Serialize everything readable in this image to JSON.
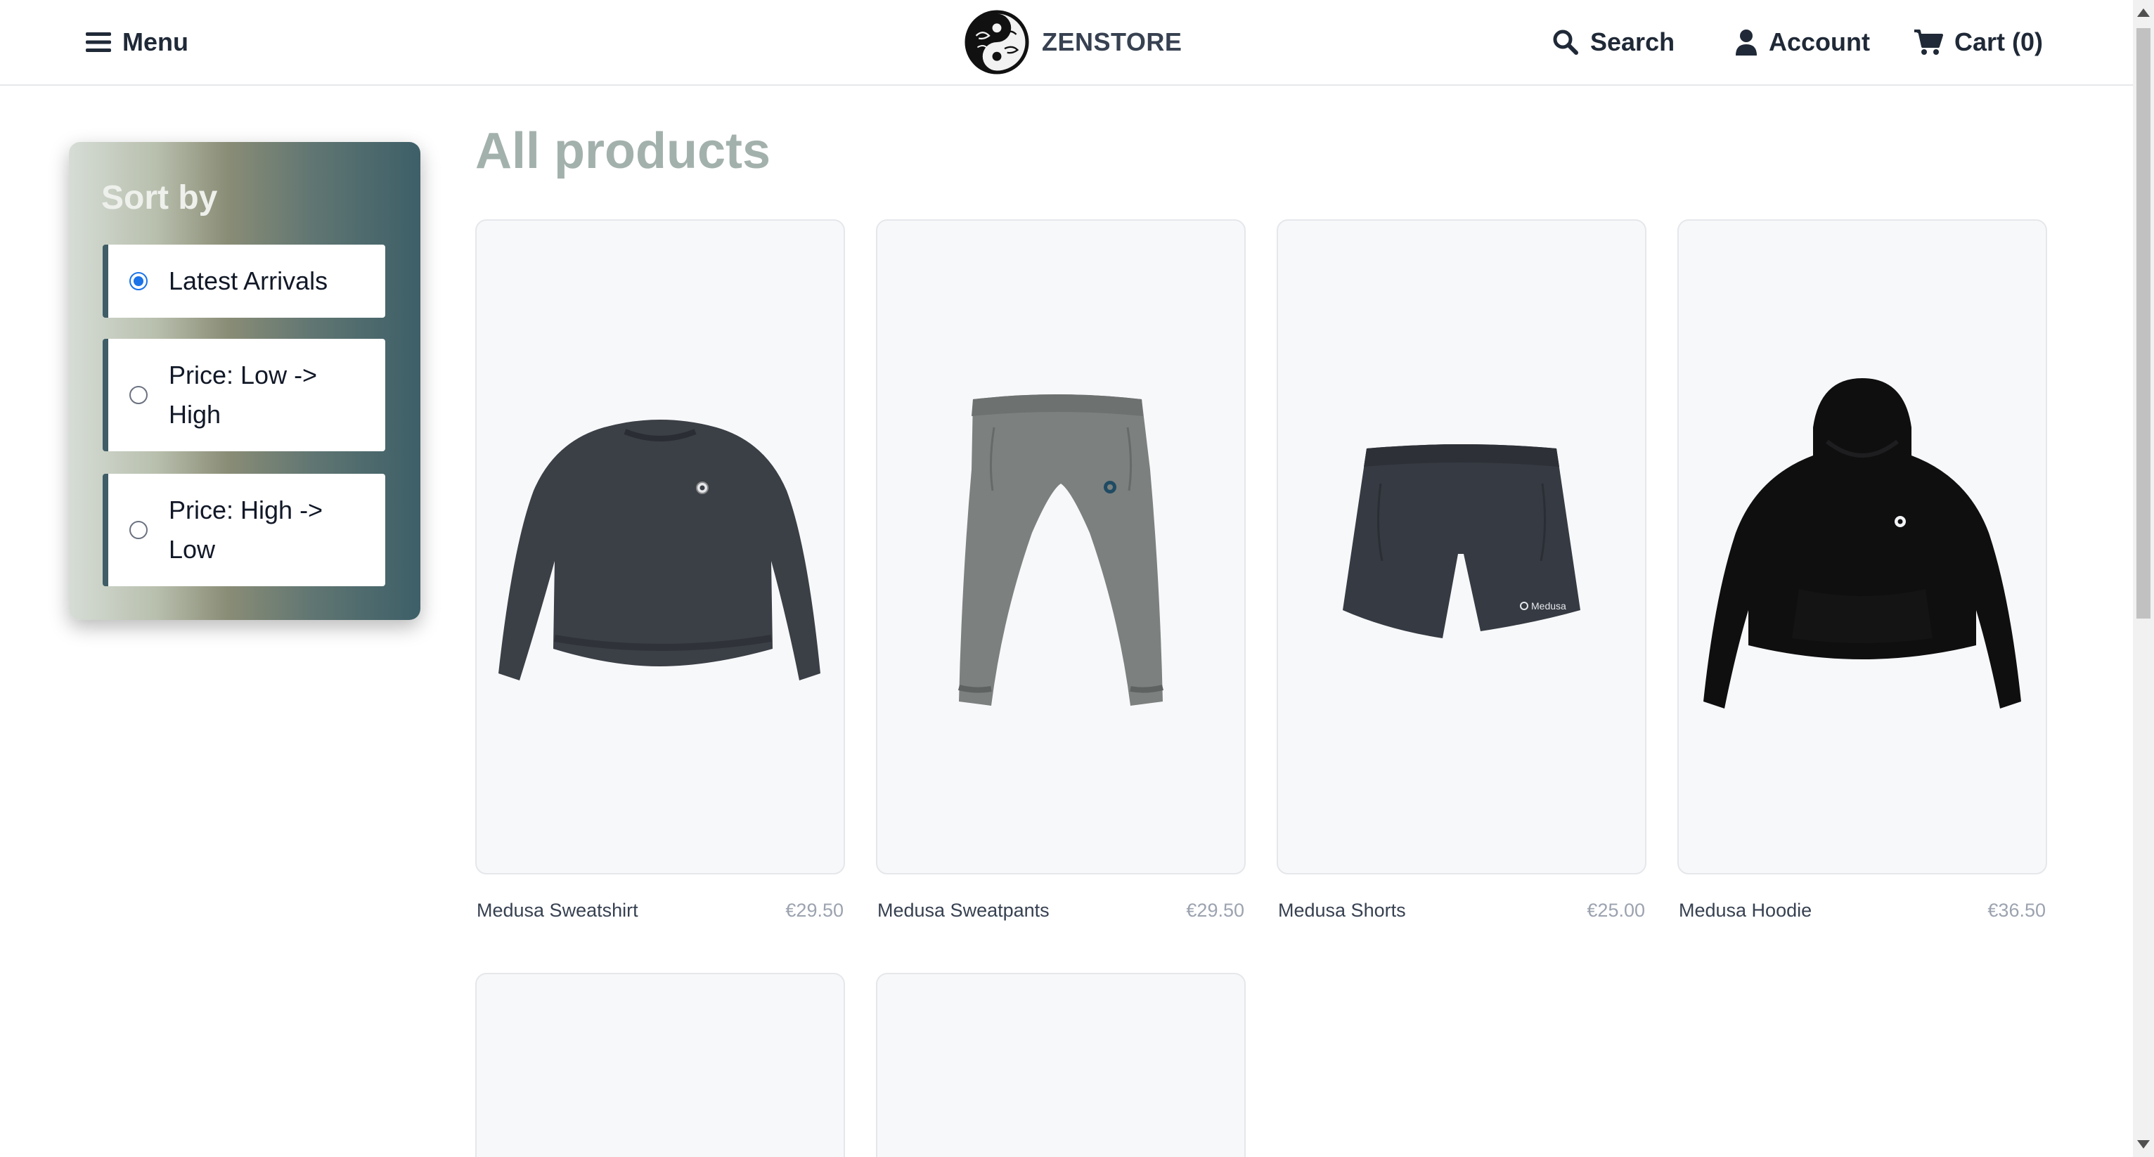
{
  "header": {
    "menu_label": "Menu",
    "brand_name": "ZENSTORE",
    "search_label": "Search",
    "account_label": "Account",
    "cart_label": "Cart (0)"
  },
  "sidebar": {
    "title": "Sort by",
    "options": [
      {
        "label": "Latest Arrivals",
        "selected": true
      },
      {
        "label": "Price: Low -> High",
        "selected": false
      },
      {
        "label": "Price: High -> Low",
        "selected": false
      }
    ]
  },
  "main": {
    "title": "All products",
    "products": [
      {
        "name": "Medusa Sweatshirt",
        "price": "€29.50",
        "icon": "sweatshirt-image"
      },
      {
        "name": "Medusa Sweatpants",
        "price": "€29.50",
        "icon": "sweatpants-image"
      },
      {
        "name": "Medusa Shorts",
        "price": "€25.00",
        "icon": "shorts-image"
      },
      {
        "name": "Medusa Hoodie",
        "price": "€36.50",
        "icon": "hoodie-image"
      }
    ]
  },
  "colors": {
    "accent": "#1a73e8",
    "title": "#a3b1ad",
    "panel_dark": "#3d5f68",
    "panel_light": "#d6ddd6"
  }
}
